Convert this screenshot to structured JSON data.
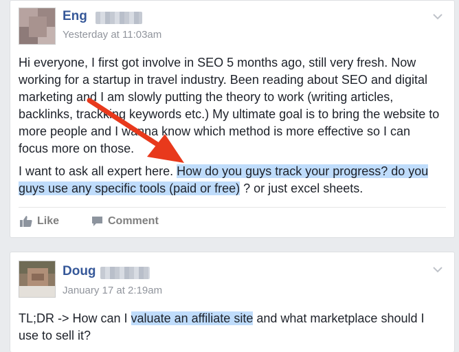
{
  "posts": [
    {
      "author_first": "Eng",
      "timestamp": "Yesterday at 11:03am",
      "para1": "Hi everyone, I first got involve in SEO 5 months ago, still very fresh. Now working for a startup in travel industry. Been reading about SEO and digital marketing and I am slowly putting the theory to work (writing articles, backlinks, trackking keywords etc.) My ultimate goal is to bring the website to more people and I wanna know which method is more effective so I can focus more on those.",
      "para2_before": "I want to ask all expert here. ",
      "para2_highlight": "How do you guys track your progress? do you guys use any specific tools (paid or free)",
      "para2_after": " ? or just excel sheets.",
      "like_label": "Like",
      "comment_label": "Comment"
    },
    {
      "author_first": "Doug",
      "timestamp": "January 17 at 2:19am",
      "text_before": "TL;DR -> How can I ",
      "text_highlight": "valuate an affiliate site",
      "text_after": " and what marketplace should I use to sell it?"
    }
  ],
  "colors": {
    "highlight": "#bfdcfb",
    "author_link": "#365899",
    "arrow": "#e8391c"
  }
}
